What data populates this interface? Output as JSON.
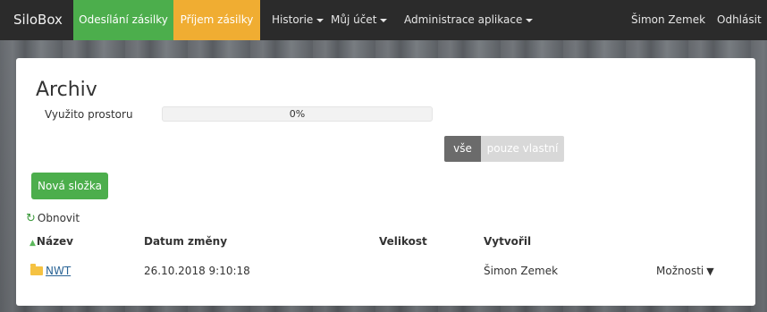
{
  "navbar": {
    "brand": "SiloBox",
    "send": "Odesílání zásilky",
    "receive": "Příjem zásilky",
    "history": "Historie",
    "account": "Můj účet",
    "admin": "Administrace aplikace",
    "user": "Šimon Zemek",
    "logout": "Odhlásit"
  },
  "archive": {
    "title": "Archiv",
    "usage_label": "Využito prostoru",
    "usage_percent": 0,
    "usage_text": "0%",
    "filter_all": "vše",
    "filter_own": "pouze vlastní",
    "new_folder": "Nová složka",
    "refresh": "Obnovit"
  },
  "table": {
    "headers": {
      "name": "Název",
      "date": "Datum změny",
      "size": "Velikost",
      "created_by": "Vytvořil"
    },
    "rows": [
      {
        "name": "NWT",
        "date": "26.10.2018 9:10:18",
        "size": "",
        "created_by": "Šimon Zemek",
        "options": "Možnosti"
      }
    ]
  },
  "colors": {
    "navbar": "#2b2b2b",
    "send_bg": "#4cae4c",
    "receive_bg": "#f0ad32",
    "primary_btn": "#4cae4c"
  }
}
